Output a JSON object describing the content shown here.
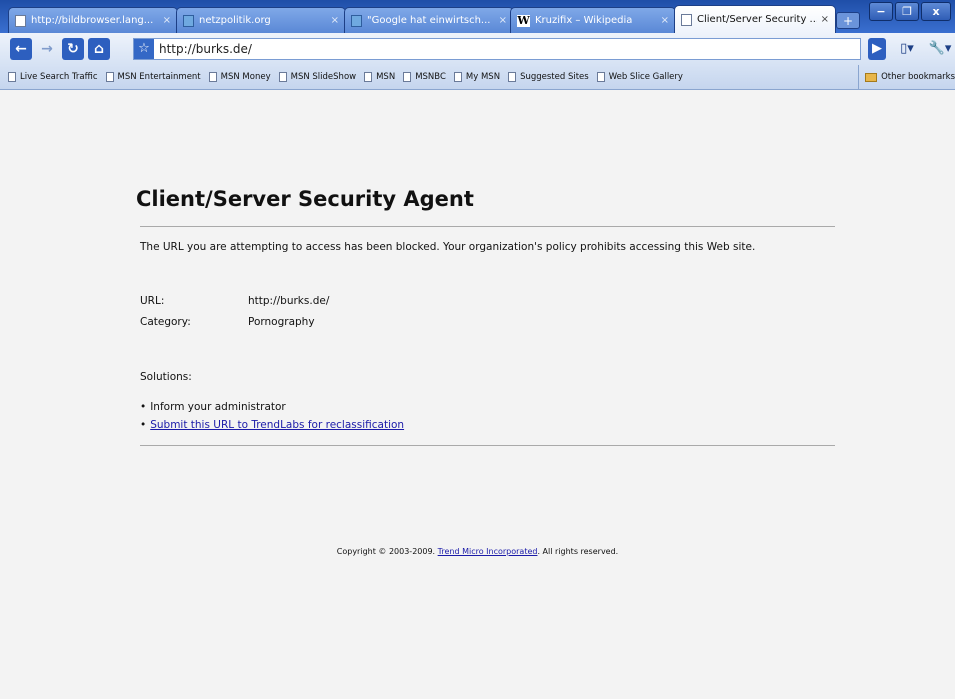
{
  "tabs": [
    {
      "title": "http://bildbrowser.lang...",
      "icon": "page-icon",
      "active": false
    },
    {
      "title": "netzpolitik.org",
      "icon": "netzpolitik-icon",
      "active": false
    },
    {
      "title": "\"Google hat einwirtsch...",
      "icon": "netzpolitik-icon",
      "active": false
    },
    {
      "title": "Kruzifix – Wikipedia",
      "icon": "wikipedia-icon",
      "active": false
    },
    {
      "title": "Client/Server Security ...",
      "icon": "page-icon",
      "active": true
    }
  ],
  "toolbar": {
    "url": "http://burks.de/"
  },
  "bookmarks": [
    "Live Search Traffic",
    "MSN Entertainment",
    "MSN Money",
    "MSN SlideShow",
    "MSN",
    "MSNBC",
    "My MSN",
    "Suggested Sites",
    "Web Slice Gallery"
  ],
  "other_bookmarks": "Other bookmarks",
  "page": {
    "title": "Client/Server Security Agent",
    "message": "The URL you are attempting to access has been blocked. Your organization's policy prohibits accessing this Web site.",
    "url_label": "URL:",
    "url_value": "http://burks.de/",
    "category_label": "Category:",
    "category_value": "Pornography",
    "solutions_label": "Solutions:",
    "solution_1": "Inform your administrator",
    "solution_2": "Submit this URL to TrendLabs for reclassification",
    "footer_prefix": "Copyright © 2003-2009.",
    "footer_link": "Trend Micro Incorporated",
    "footer_suffix": ". All rights reserved."
  }
}
